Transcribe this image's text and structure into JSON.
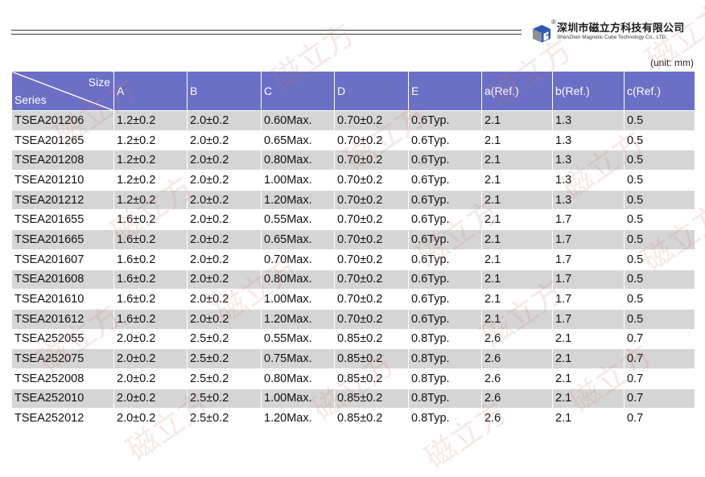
{
  "brand": {
    "name_cn": "深圳市磁立方科技有限公司",
    "name_en": "ShenZhen Magnetic Cube Technology Co., LTD.",
    "registered_mark": "®"
  },
  "watermark_text": "磁立方",
  "unit_note": "(unit: mm)",
  "table": {
    "corner_top": "Size",
    "corner_bottom": "Series",
    "headers": [
      "A",
      "B",
      "C",
      "D",
      "E",
      "a(Ref.)",
      "b(Ref.)",
      "c(Ref.)"
    ],
    "rows": [
      [
        "TSEA201206",
        "1.2±0.2",
        "2.0±0.2",
        "0.60Max.",
        "0.70±0.2",
        "0.6Typ.",
        "2.1",
        "1.3",
        "0.5"
      ],
      [
        "TSEA201265",
        "1.2±0.2",
        "2.0±0.2",
        "0.65Max.",
        "0.70±0.2",
        "0.6Typ.",
        "2.1",
        "1.3",
        "0.5"
      ],
      [
        "TSEA201208",
        "1.2±0.2",
        "2.0±0.2",
        "0.80Max.",
        "0.70±0.2",
        "0.6Typ.",
        "2.1",
        "1.3",
        "0.5"
      ],
      [
        "TSEA201210",
        "1.2±0.2",
        "2.0±0.2",
        "1.00Max.",
        "0.70±0.2",
        "0.6Typ.",
        "2.1",
        "1.3",
        "0.5"
      ],
      [
        "TSEA201212",
        "1.2±0.2",
        "2.0±0.2",
        "1.20Max.",
        "0.70±0.2",
        "0.6Typ.",
        "2.1",
        "1.3",
        "0.5"
      ],
      [
        "TSEA201655",
        "1.6±0.2",
        "2.0±0.2",
        "0.55Max.",
        "0.70±0.2",
        "0.6Typ.",
        "2.1",
        "1.7",
        "0.5"
      ],
      [
        "TSEA201665",
        "1.6±0.2",
        "2.0±0.2",
        "0.65Max.",
        "0.70±0.2",
        "0.6Typ.",
        "2.1",
        "1.7",
        "0.5"
      ],
      [
        "TSEA201607",
        "1.6±0.2",
        "2.0±0.2",
        "0.70Max.",
        "0.70±0.2",
        "0.6Typ.",
        "2.1",
        "1.7",
        "0.5"
      ],
      [
        "TSEA201608",
        "1.6±0.2",
        "2.0±0.2",
        "0.80Max.",
        "0.70±0.2",
        "0.6Typ.",
        "2.1",
        "1.7",
        "0.5"
      ],
      [
        "TSEA201610",
        "1.6±0.2",
        "2.0±0.2",
        "1.00Max.",
        "0.70±0.2",
        "0.6Typ.",
        "2.1",
        "1.7",
        "0.5"
      ],
      [
        "TSEA201612",
        "1.6±0.2",
        "2.0±0.2",
        "1.20Max.",
        "0.70±0.2",
        "0.6Typ.",
        "2.1",
        "1.7",
        "0.5"
      ],
      [
        "TSEA252055",
        "2.0±0.2",
        "2.5±0.2",
        "0.55Max.",
        "0.85±0.2",
        "0.8Typ.",
        "2.6",
        "2.1",
        "0.7"
      ],
      [
        "TSEA252075",
        "2.0±0.2",
        "2.5±0.2",
        "0.75Max.",
        "0.85±0.2",
        "0.8Typ.",
        "2.6",
        "2.1",
        "0.7"
      ],
      [
        "TSEA252008",
        "2.0±0.2",
        "2.5±0.2",
        "0.80Max.",
        "0.85±0.2",
        "0.8Typ.",
        "2.6",
        "2.1",
        "0.7"
      ],
      [
        "TSEA252010",
        "2.0±0.2",
        "2.5±0.2",
        "1.00Max.",
        "0.85±0.2",
        "0.8Typ.",
        "2.6",
        "2.1",
        "0.7"
      ],
      [
        "TSEA252012",
        "2.0±0.2",
        "2.5±0.2",
        "1.20Max.",
        "0.85±0.2",
        "0.8Typ.",
        "2.6",
        "2.1",
        "0.7"
      ]
    ]
  },
  "colors": {
    "header_bg": "#6b6fc6",
    "row_shade": "#d5d5d5",
    "logo_blue": "#2b57b5",
    "logo_gray": "#8a8f96"
  }
}
